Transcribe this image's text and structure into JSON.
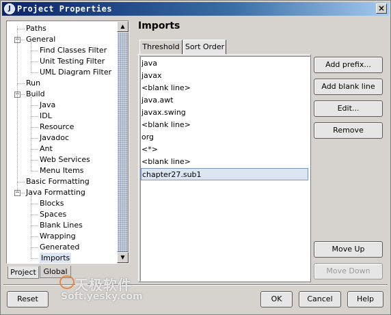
{
  "window": {
    "title": "Project Properties",
    "close_glyph": "×",
    "title_icon": "J"
  },
  "tree": {
    "items": [
      {
        "label": "Paths",
        "level": 0,
        "expander": ""
      },
      {
        "label": "General",
        "level": 0,
        "expander": "−"
      },
      {
        "label": "Find Classes Filter",
        "level": 1,
        "expander": ""
      },
      {
        "label": "Unit Testing Filter",
        "level": 1,
        "expander": ""
      },
      {
        "label": "UML Diagram Filter",
        "level": 1,
        "expander": ""
      },
      {
        "label": "Run",
        "level": 0,
        "expander": ""
      },
      {
        "label": "Build",
        "level": 0,
        "expander": "−"
      },
      {
        "label": "Java",
        "level": 1,
        "expander": ""
      },
      {
        "label": "IDL",
        "level": 1,
        "expander": ""
      },
      {
        "label": "Resource",
        "level": 1,
        "expander": ""
      },
      {
        "label": "Javadoc",
        "level": 1,
        "expander": ""
      },
      {
        "label": "Ant",
        "level": 1,
        "expander": ""
      },
      {
        "label": "Web Services",
        "level": 1,
        "expander": ""
      },
      {
        "label": "Menu Items",
        "level": 1,
        "expander": ""
      },
      {
        "label": "Basic Formatting",
        "level": 0,
        "expander": ""
      },
      {
        "label": "Java Formatting",
        "level": 0,
        "expander": "−"
      },
      {
        "label": "Blocks",
        "level": 1,
        "expander": ""
      },
      {
        "label": "Spaces",
        "level": 1,
        "expander": ""
      },
      {
        "label": "Blank Lines",
        "level": 1,
        "expander": ""
      },
      {
        "label": "Wrapping",
        "level": 1,
        "expander": ""
      },
      {
        "label": "Generated",
        "level": 1,
        "expander": ""
      },
      {
        "label": "Imports",
        "level": 1,
        "expander": "",
        "selected": true
      }
    ],
    "scroll_up": "▲",
    "scroll_down": "▼"
  },
  "left_tabs": {
    "project": "Project",
    "global": "Global",
    "active": "project"
  },
  "panel": {
    "title": "Imports",
    "tabs": [
      {
        "label": "Threshold",
        "active": false
      },
      {
        "label": "Sort Order",
        "active": true
      }
    ],
    "imports": [
      "java",
      "javax",
      "<blank line>",
      "java.awt",
      "javax.swing",
      "<blank line>",
      "org",
      "<*>",
      "<blank line>",
      "chapter27.sub1"
    ],
    "selected_index": 9
  },
  "buttons": {
    "add_prefix": "Add prefix...",
    "add_blank_line": "Add blank line",
    "edit": "Edit...",
    "remove": "Remove",
    "move_up": "Move Up",
    "move_down": "Move Down",
    "reset": "Reset",
    "ok": "OK",
    "cancel": "Cancel",
    "help": "Help"
  },
  "watermark": {
    "line1": "天极软件",
    "line2": "Soft.yesky.com"
  }
}
